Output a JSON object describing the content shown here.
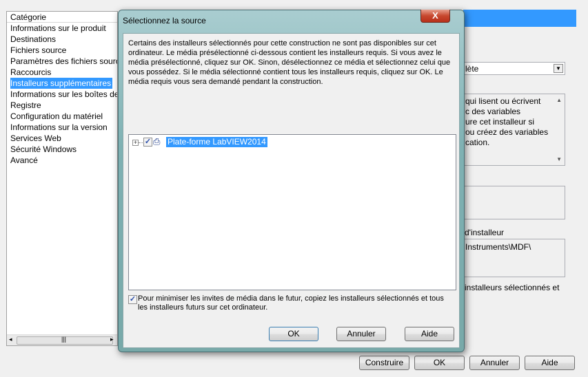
{
  "sidebar": {
    "header": "Catégorie",
    "items": [
      {
        "label": "Informations sur le produit"
      },
      {
        "label": "Destinations"
      },
      {
        "label": "Fichiers source"
      },
      {
        "label": "Paramètres des fichiers source"
      },
      {
        "label": "Raccourcis"
      },
      {
        "label": "Installeurs supplémentaires",
        "selected": true
      },
      {
        "label": "Informations sur les boîtes de dialogue"
      },
      {
        "label": "Registre"
      },
      {
        "label": "Configuration du matériel"
      },
      {
        "label": "Informations sur la version"
      },
      {
        "label": "Services Web"
      },
      {
        "label": "Sécurité Windows"
      },
      {
        "label": "Avancé"
      }
    ]
  },
  "right": {
    "dropdown_value": "lète",
    "description_lines": [
      "qui lisent ou écrivent",
      "c des variables",
      "ure cet installeur si",
      "ou créez des variables",
      "cation."
    ],
    "path_label": "d'installeur",
    "path_value": "Instruments\\MDF\\",
    "checkbox_text": "installeurs sélectionnés et"
  },
  "footer": {
    "build": "Construire",
    "ok": "OK",
    "cancel": "Annuler",
    "help": "Aide"
  },
  "dialog": {
    "title": "Sélectionnez la source",
    "close": "X",
    "message": "Certains des installeurs sélectionnés pour cette construction ne sont pas disponibles sur cet ordinateur. Le média présélectionné ci-dessous contient les installeurs requis. Si vous avez le média présélectionné, cliquez sur OK. Sinon, désélectionnez ce média et sélectionnez celui que vous possédez. Si le média sélectionné contient tous les installeurs requis, cliquez sur OK. Le média requis vous sera demandé pendant la construction.",
    "tree_item": "Plate-forme LabVIEW2014",
    "tree_checked": true,
    "copy_checkbox": "Pour minimiser les invites de média dans le futur, copiez les installeurs sélectionnés et tous les installeurs futurs sur cet ordinateur.",
    "copy_checked": true,
    "ok": "OK",
    "cancel": "Annuler",
    "help": "Aide"
  },
  "colors": {
    "selection": "#3399ff",
    "dialog_frame": "#7fb1b3"
  }
}
